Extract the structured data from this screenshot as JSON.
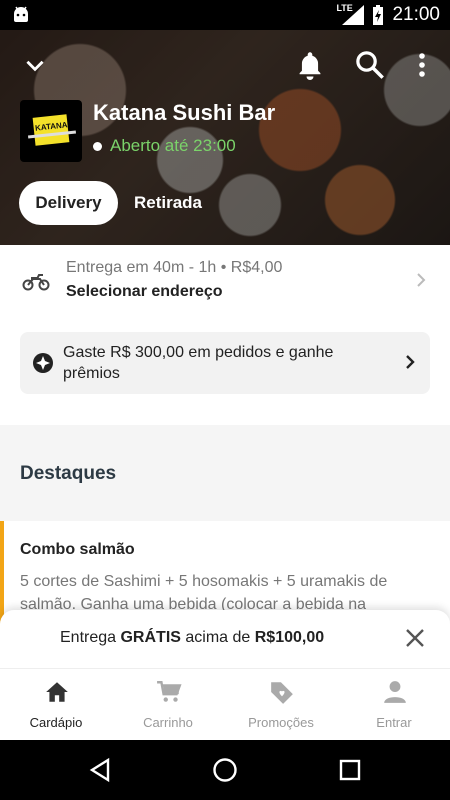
{
  "status_bar": {
    "network": "LTE",
    "time": "21:00"
  },
  "header_icons": [
    "chevron-down-icon",
    "bell-icon",
    "search-icon",
    "more-vert-icon"
  ],
  "restaurant": {
    "name": "Katana Sushi Bar",
    "logo_text": "KATANA",
    "status": "Aberto até 23:00"
  },
  "order_tabs": {
    "delivery": "Delivery",
    "pickup": "Retirada",
    "selected": "Delivery"
  },
  "delivery": {
    "info": "Entrega em 40m - 1h • R$4,00",
    "address_cta": "Selecionar endereço"
  },
  "promo": {
    "text": "Gaste R$ 300,00 em pedidos e ganhe prêmios"
  },
  "highlights": {
    "title": "Destaques"
  },
  "product": {
    "name": "Combo salmão",
    "description": "5 cortes de Sashimi + 5 hosomakis + 5 uramakis de salmão. Ganha uma bebida (colocar a bebida na"
  },
  "toast": {
    "prefix": "Entrega ",
    "bold1": "GRÁTIS",
    "middle": " acima de ",
    "bold2": "R$100,00"
  },
  "bottom_nav": [
    {
      "label": "Cardápio",
      "icon": "home-icon",
      "active": true
    },
    {
      "label": "Carrinho",
      "icon": "cart-icon",
      "active": false
    },
    {
      "label": "Promoções",
      "icon": "tag-heart-icon",
      "active": false
    },
    {
      "label": "Entrar",
      "icon": "person-icon",
      "active": false
    }
  ],
  "colors": {
    "accent": "#f2a516",
    "open_green": "#7bd36a"
  }
}
